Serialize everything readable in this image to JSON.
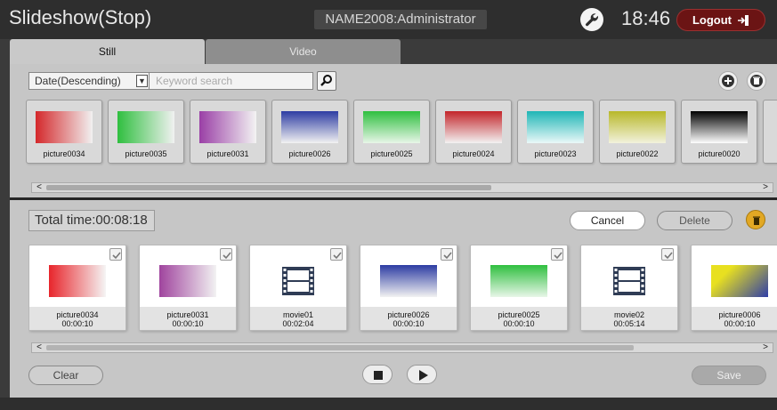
{
  "header": {
    "title": "Slideshow(Stop)",
    "user": "NAME2008:Administrator",
    "time": "18:46",
    "logout_label": "Logout"
  },
  "tabs": [
    {
      "label": "Still",
      "active": true
    },
    {
      "label": "Video",
      "active": false
    }
  ],
  "library": {
    "sort_value": "Date(Descending)",
    "search_placeholder": "Keyword search",
    "items": [
      {
        "label": "picture0034",
        "gradient": "linear-gradient(to right, #d4282b, #f1f1f1)"
      },
      {
        "label": "picture0035",
        "gradient": "linear-gradient(to right, #2fbf3f, #f1f1f1)"
      },
      {
        "label": "picture0031",
        "gradient": "linear-gradient(to right, #9a3fa6, #f3f3f3)"
      },
      {
        "label": "picture0026",
        "gradient": "linear-gradient(to bottom, #2d3ca3, #f2f2f2)"
      },
      {
        "label": "picture0025",
        "gradient": "linear-gradient(to bottom, #2fbf3f, #e8f6e8)"
      },
      {
        "label": "picture0024",
        "gradient": "linear-gradient(to bottom, #c3252a, #f2f2f2)"
      },
      {
        "label": "picture0023",
        "gradient": "linear-gradient(to bottom, #1fb6b6, #eaf8f8)"
      },
      {
        "label": "picture0022",
        "gradient": "linear-gradient(to bottom, #b8b82a, #f2f2dc)"
      },
      {
        "label": "picture0020",
        "gradient": "linear-gradient(to bottom, #000000, #ffffff)"
      }
    ]
  },
  "playlist": {
    "total_time": "Total time:00:08:18",
    "cancel_label": "Cancel",
    "delete_label": "Delete",
    "clear_label": "Clear",
    "save_label": "Save",
    "items": [
      {
        "name": "picture0034",
        "duration": "00:00:10",
        "kind": "image",
        "gradient": "linear-gradient(to right, #e8252b, #f5f5f5)"
      },
      {
        "name": "picture0031",
        "duration": "00:00:10",
        "kind": "image",
        "gradient": "linear-gradient(to right, #a0449e, #f2f2f2)"
      },
      {
        "name": "movie01",
        "duration": "00:02:04",
        "kind": "video",
        "gradient": ""
      },
      {
        "name": "picture0026",
        "duration": "00:00:10",
        "kind": "image",
        "gradient": "linear-gradient(to bottom, #2d3ca3, #f2f2f2)"
      },
      {
        "name": "picture0025",
        "duration": "00:00:10",
        "kind": "image",
        "gradient": "linear-gradient(to bottom, #2fbf3f, #e8f6e8)"
      },
      {
        "name": "movie02",
        "duration": "00:05:14",
        "kind": "video",
        "gradient": ""
      },
      {
        "name": "picture0006",
        "duration": "00:00:10",
        "kind": "image",
        "gradient": "linear-gradient(135deg, #e8e020 25%, #2f3ea8 100%)"
      }
    ]
  },
  "colors": {
    "logout": "#6b1414",
    "trash_accent": "#e2a824",
    "panel": "#c6c6c6"
  },
  "icons": {
    "settings": "wrench-icon",
    "logout": "exit-icon",
    "search": "magnifier-icon",
    "add": "plus-circle-icon",
    "trash": "trash-icon",
    "stop": "stop-icon",
    "play": "play-icon",
    "video": "film-strip-icon"
  }
}
